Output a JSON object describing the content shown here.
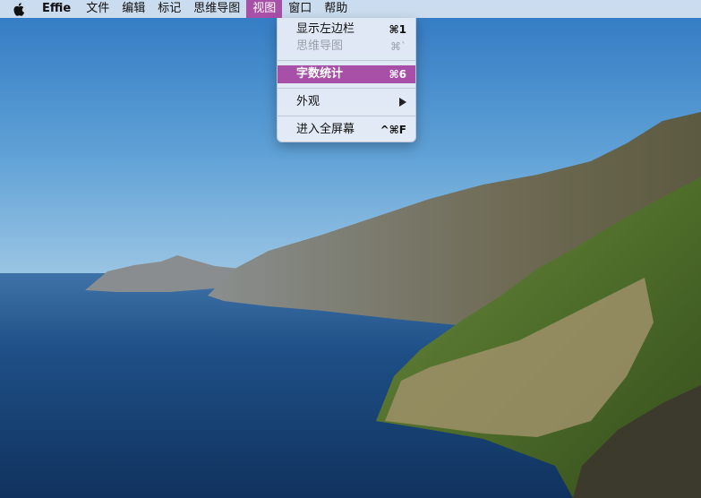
{
  "menubar": {
    "apple_icon": "apple-icon",
    "app_name": "Effie",
    "items": [
      "文件",
      "编辑",
      "标记",
      "思维导图",
      "视图",
      "窗口",
      "帮助"
    ],
    "active_index": 4
  },
  "view_menu": {
    "items": [
      {
        "label": "显示左边栏",
        "shortcut": "⌘1"
      },
      {
        "label": "思维导图",
        "shortcut": "⌘`",
        "disabled": true
      },
      {
        "label": "字数统计",
        "shortcut": "⌘6",
        "highlighted": true
      },
      {
        "label": "外观",
        "submenu_icon": "triangle-right-icon"
      },
      {
        "label": "进入全屏幕",
        "shortcut": "^⌘F"
      }
    ]
  },
  "colors": {
    "accent": "#a84fa8",
    "menubar_bg": "#e4ecf6"
  }
}
